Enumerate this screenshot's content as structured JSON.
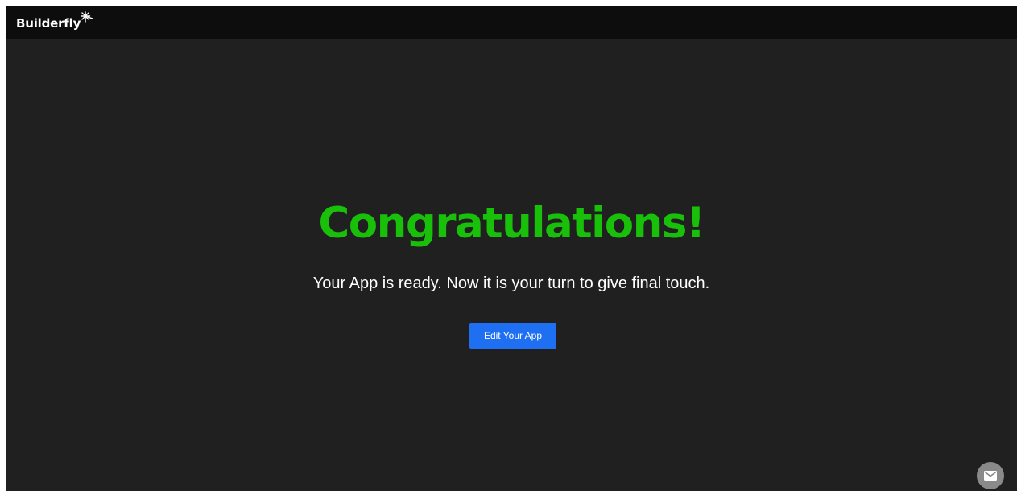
{
  "header": {
    "logo_text": "Builderfly",
    "logo_icon": "dragonfly-star-icon"
  },
  "main": {
    "headline": "Congratulations!",
    "subtitle": "Your App is ready. Now it is your turn to give final touch.",
    "edit_button_label": "Edit Your App"
  },
  "fab": {
    "icon": "mail-icon"
  },
  "colors": {
    "page_background": "#202020",
    "header_background": "#0d0d0d",
    "headline": "#19c00a",
    "button": "#1f6ff2",
    "fab": "#8a8a8a"
  }
}
